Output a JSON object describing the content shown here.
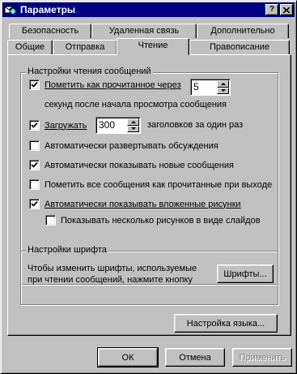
{
  "window": {
    "title": "Параметры",
    "help_label": "?",
    "close_label": "×"
  },
  "tabs_back": [
    {
      "label": "Безопасность"
    },
    {
      "label": "Удаленная связь"
    },
    {
      "label": "Дополнительно"
    }
  ],
  "tabs_front": [
    {
      "label": "Общие"
    },
    {
      "label": "Отправка"
    },
    {
      "label": "Чтение",
      "active": true
    },
    {
      "label": "Правописание"
    }
  ],
  "reading_group": {
    "title": "Настройки чтения сообщений",
    "mark_read": {
      "label": "Пометить как прочитанное через",
      "checked": true,
      "value": "5",
      "suffix": "секунд после начала просмотра сообщения"
    },
    "download": {
      "label": "Загружать",
      "checked": true,
      "value": "300",
      "suffix": "заголовков за один раз"
    },
    "options": [
      {
        "label": "Автоматически развертывать обсуждения",
        "checked": false
      },
      {
        "label": "Автоматически показывать новые сообщения",
        "checked": true
      },
      {
        "label": "Пометить все сообщения как прочитанные при выходе",
        "checked": false
      },
      {
        "label": "Автоматически показывать вложенные рисунки",
        "checked": true
      }
    ],
    "slideshow": {
      "label": "Показывать несколько рисунков в виде слайдов",
      "checked": false
    }
  },
  "font_group": {
    "title": "Настройки шрифта",
    "description_line1": "Чтобы изменить шрифты, используемые",
    "description_line2": "при чтении сообщений, нажмите кнопку",
    "button_label": "Шрифты..."
  },
  "language_button": "Настройка языка...",
  "footer": {
    "ok": "ОК",
    "cancel": "Отмена",
    "apply": "Применить"
  }
}
